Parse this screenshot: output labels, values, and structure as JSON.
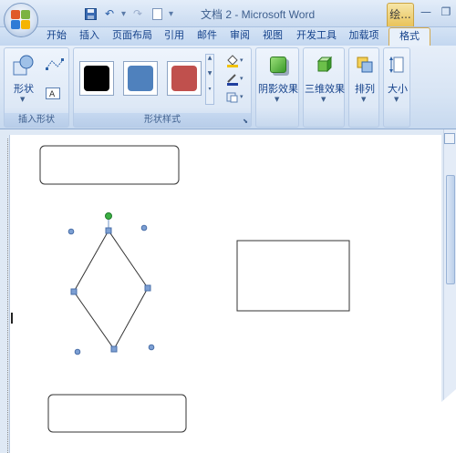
{
  "window": {
    "title": "文档 2 - Microsoft Word",
    "tool_tab": "绘..."
  },
  "tabs": [
    {
      "label": "开始"
    },
    {
      "label": "插入"
    },
    {
      "label": "页面布局"
    },
    {
      "label": "引用"
    },
    {
      "label": "邮件"
    },
    {
      "label": "审阅"
    },
    {
      "label": "视图"
    },
    {
      "label": "开发工具"
    },
    {
      "label": "加载项"
    },
    {
      "label": "格式",
      "active": true
    }
  ],
  "ribbon": {
    "insert_shapes": {
      "label": "插入形状",
      "shapes_button": "形状"
    },
    "shape_styles": {
      "label": "形状样式",
      "swatches": [
        {
          "color": "#000000"
        },
        {
          "color": "#4f81bd"
        },
        {
          "color": "#c0504d"
        }
      ]
    },
    "shadow_effects": {
      "label": "阴影效果"
    },
    "threed_effects": {
      "label": "三维效果"
    },
    "arrange": {
      "label": "排列"
    },
    "size": {
      "label": "大小"
    }
  },
  "colors": {
    "accent": "#15428b",
    "selection_handle": "#6f93c6",
    "rotation_handle": "#3cb043"
  }
}
